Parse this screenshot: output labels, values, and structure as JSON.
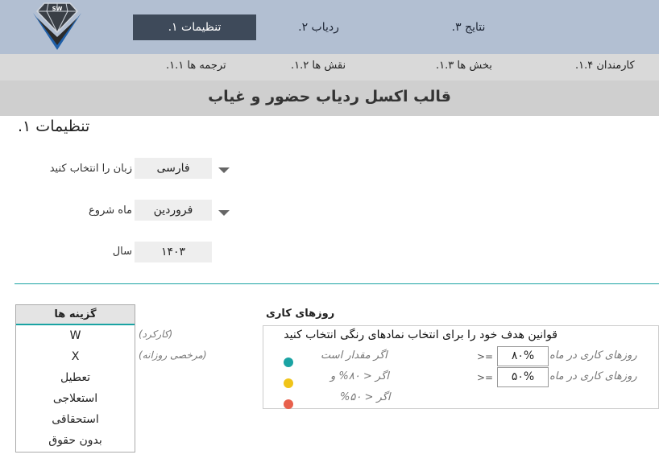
{
  "logo": {
    "text": "SW",
    "colors": [
      "#1f5fa8",
      "#2b2b2b"
    ]
  },
  "nav": {
    "tabs": [
      {
        "label": "تنظیمات ۱.",
        "active": true
      },
      {
        "label": "ردیاب ۲.",
        "active": false
      },
      {
        "label": "نتایج ۳.",
        "active": false
      }
    ]
  },
  "subnav": {
    "items": [
      {
        "label": "ترجمه ها ۱.۱."
      },
      {
        "label": "نقش ها ۱.۲."
      },
      {
        "label": "بخش ها ۱.۳."
      },
      {
        "label": "کارمندان ۱.۴."
      }
    ]
  },
  "title": "قالب اکسل ردیاب حضور و غیاب",
  "section_heading": "تنظیمات ۱.",
  "settings": {
    "language": {
      "label": "زبان را انتخاب کنید",
      "value": "فارسی"
    },
    "start_month": {
      "label": "ماه شروع",
      "value": "فروردین"
    },
    "year": {
      "label": "سال",
      "value": "۱۴۰۳"
    }
  },
  "options": {
    "header": "گزینه ها",
    "items": [
      "W",
      "X",
      "تعطیل",
      "استعلاجی",
      "استحقاقی",
      "بدون حقوق"
    ],
    "notes": [
      "(کارکرد)",
      "(مرخصی روزانه)"
    ]
  },
  "working_days": {
    "title": "روزهای کاری",
    "instruction": "قوانین هدف خود را برای انتخاب نمادهای رنگی انتخاب کنید",
    "rules": [
      {
        "label": "روزهای کاری در ماه",
        "operator": ">=",
        "value": "۸۰%",
        "condition": "اگر مقدار است",
        "color": "#1aa3a3"
      },
      {
        "label": "روزهای کاری در ماه",
        "operator": ">=",
        "value": "۵۰%",
        "condition": "اگر < ۸۰% و",
        "color": "#f0c419"
      },
      {
        "label": "",
        "operator": "",
        "value": "",
        "condition": "اگر < ۵۰%",
        "color": "#e8604c"
      }
    ]
  }
}
